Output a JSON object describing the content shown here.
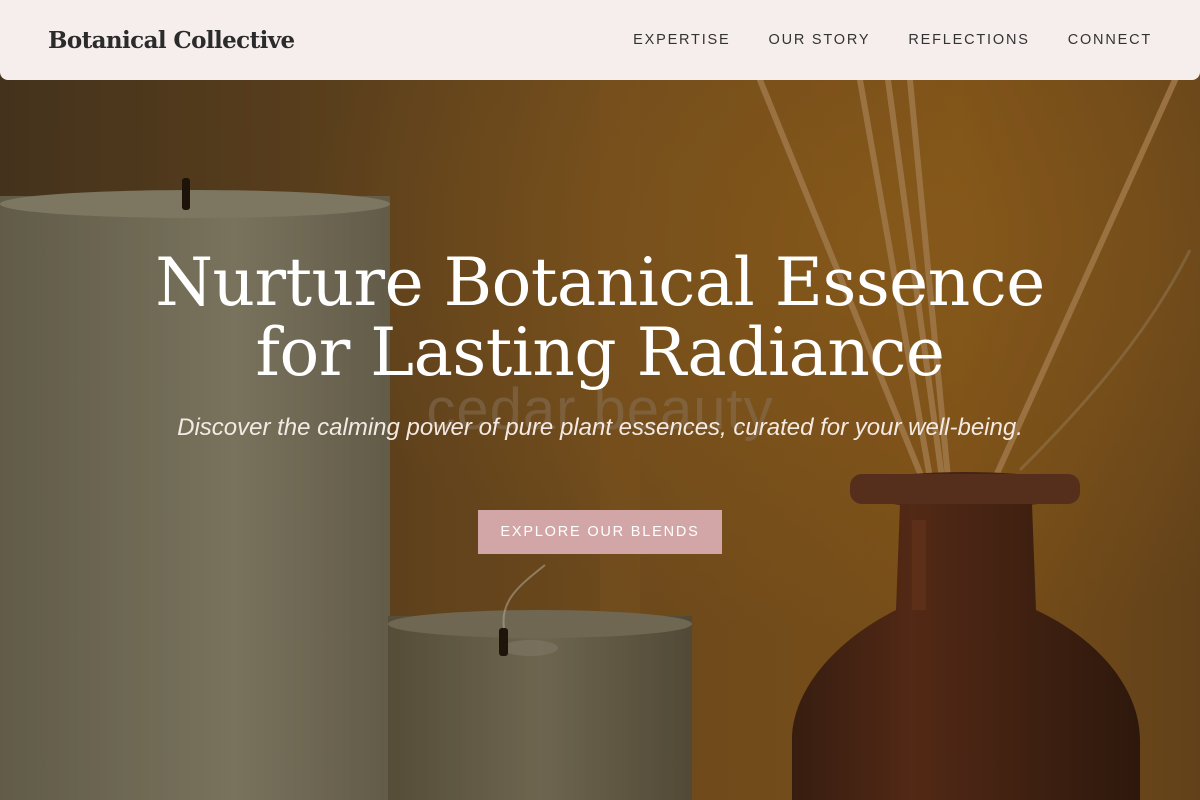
{
  "brand": {
    "name": "Botanical Collective"
  },
  "nav": {
    "items": [
      "EXPERTISE",
      "OUR STORY",
      "REFLECTIONS",
      "CONNECT"
    ]
  },
  "hero": {
    "ghost_text": "cedar beauty",
    "headline_line1": "Nurture Botanical Essence",
    "headline_line2": "for Lasting Radiance",
    "subline": "Discover the calming power of pure plant essences, curated for your well-being.",
    "cta_label": "EXPLORE OUR BLENDS",
    "background": "candles and reed diffuser"
  },
  "colors": {
    "nav_bg": "#f6eeec",
    "cta_bg": "#d2a6a6",
    "headline": "#ffffff"
  }
}
